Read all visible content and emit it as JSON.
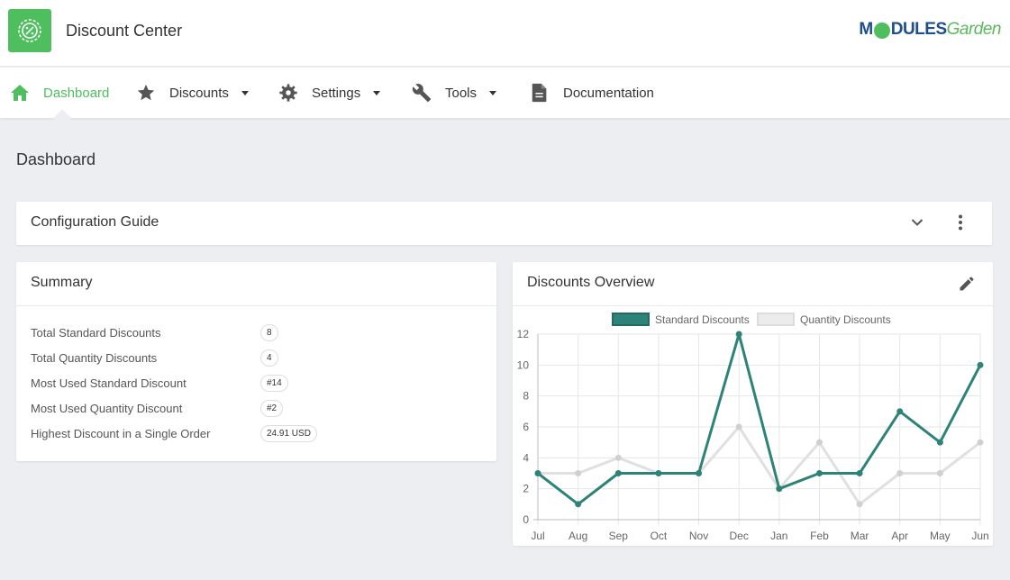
{
  "header": {
    "app_title": "Discount Center",
    "brand_left": "M",
    "brand_mid": "DULES",
    "brand_right": "Garden"
  },
  "nav": [
    {
      "label": "Dashboard",
      "icon": "home-icon",
      "active": true
    },
    {
      "label": "Discounts",
      "icon": "star-icon",
      "dropdown": true
    },
    {
      "label": "Settings",
      "icon": "gear-icon",
      "dropdown": true
    },
    {
      "label": "Tools",
      "icon": "wrench-icon",
      "dropdown": true
    },
    {
      "label": "Documentation",
      "icon": "document-icon"
    }
  ],
  "page": {
    "title": "Dashboard"
  },
  "config_guide": {
    "title": "Configuration Guide"
  },
  "summary": {
    "title": "Summary",
    "rows": [
      {
        "label": "Total Standard Discounts",
        "value": "8"
      },
      {
        "label": "Total Quantity Discounts",
        "value": "4"
      },
      {
        "label": "Most Used Standard Discount",
        "value": "#14"
      },
      {
        "label": "Most Used Quantity Discount",
        "value": "#2"
      },
      {
        "label": "Highest Discount in a Single Order",
        "value": "24.91 USD"
      }
    ]
  },
  "overview": {
    "title": "Discounts Overview"
  },
  "colors": {
    "accent": "#4fbe5e",
    "standard": "#2e8379",
    "quantity": "#e0e0e0"
  },
  "chart_data": {
    "type": "line",
    "categories": [
      "Jul",
      "Aug",
      "Sep",
      "Oct",
      "Nov",
      "Dec",
      "Jan",
      "Feb",
      "Mar",
      "Apr",
      "May",
      "Jun"
    ],
    "series": [
      {
        "name": "Standard Discounts",
        "values": [
          3,
          1,
          3,
          3,
          3,
          12,
          2,
          3,
          3,
          7,
          5,
          10
        ]
      },
      {
        "name": "Quantity Discounts",
        "values": [
          3,
          3,
          4,
          3,
          3,
          6,
          2,
          5,
          1,
          3,
          3,
          5
        ]
      }
    ],
    "ylim": [
      0,
      12
    ],
    "yticks": [
      "0",
      "2",
      "4",
      "6",
      "8",
      "10",
      "12"
    ],
    "grid": true,
    "legend": "top"
  }
}
